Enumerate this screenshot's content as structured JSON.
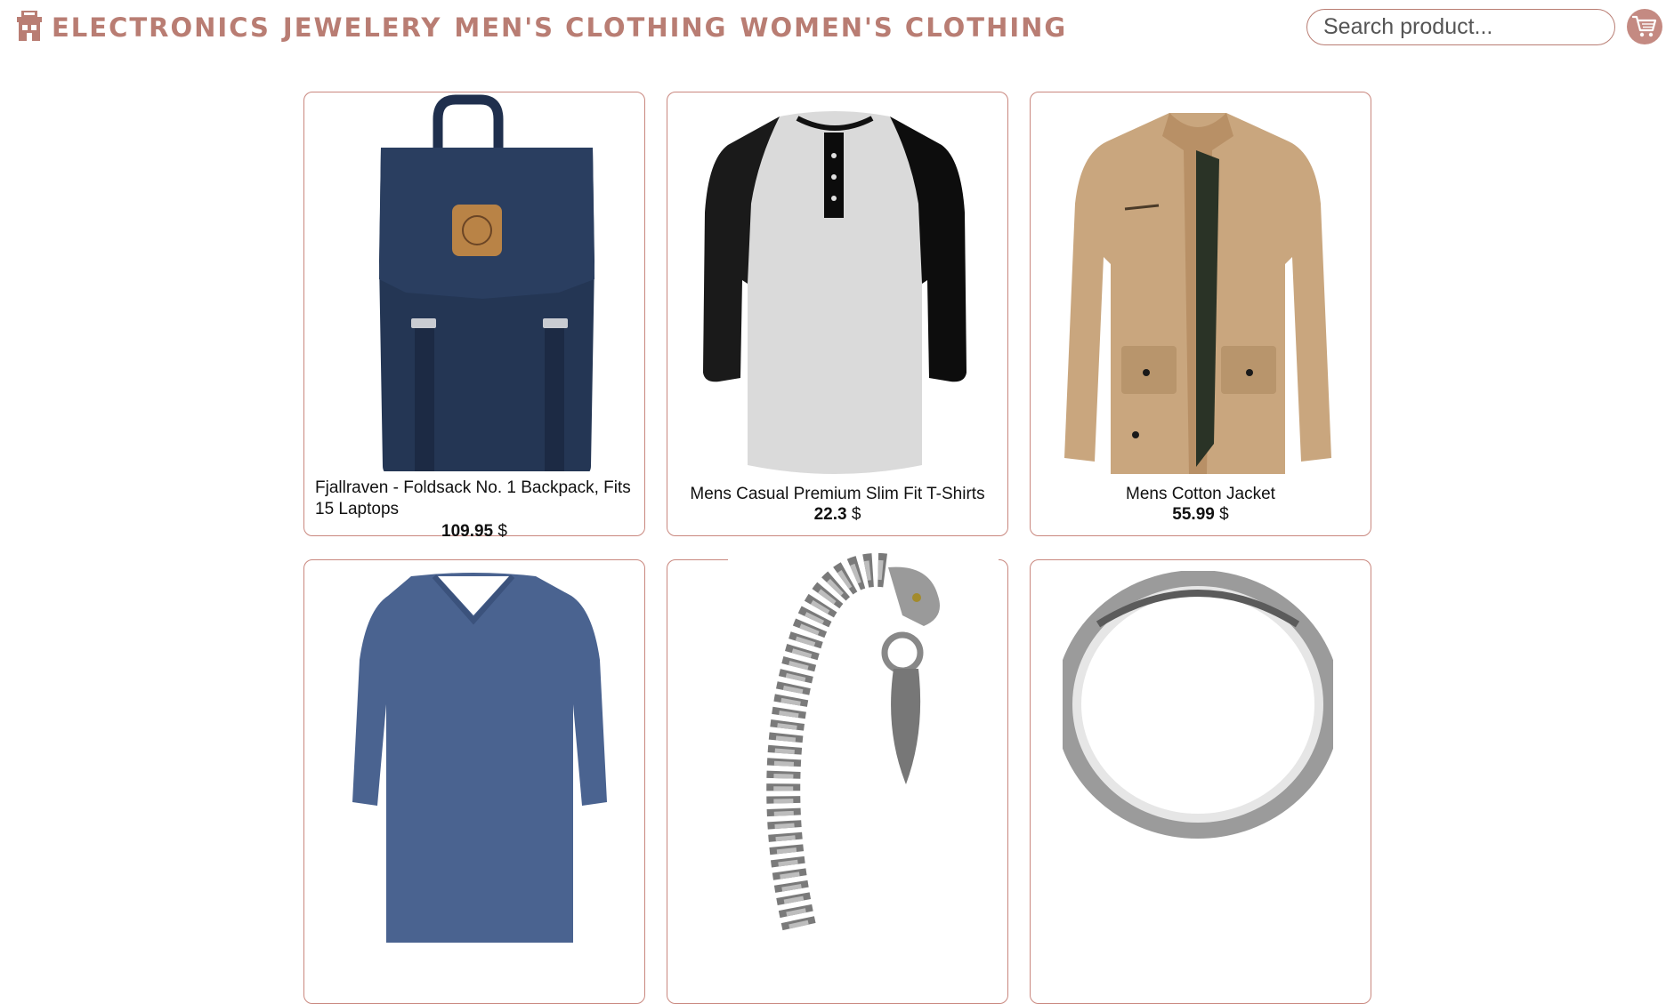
{
  "nav": {
    "logo_icon": "store-icon",
    "items": [
      {
        "label": "ELECTRONICS"
      },
      {
        "label": "JEWELERY"
      },
      {
        "label": "MEN'S CLOTHING"
      },
      {
        "label": "WOMEN'S CLOTHING"
      }
    ]
  },
  "search": {
    "placeholder": "Search product...",
    "value": ""
  },
  "cart": {
    "icon": "cart-icon"
  },
  "colors": {
    "accent": "#b97d73",
    "cart_bg": "#c48a82",
    "card_border": "#c9877e"
  },
  "currency": "$",
  "products": [
    {
      "title": "Fjallraven - Foldsack No. 1 Backpack, Fits 15 Laptops",
      "price": "109.95",
      "image": "navy-backpack"
    },
    {
      "title": "Mens Casual Premium Slim Fit T-Shirts",
      "price": "22.3",
      "image": "raglan-henley-tshirt"
    },
    {
      "title": "Mens Cotton Jacket",
      "price": "55.99",
      "image": "khaki-cotton-jacket"
    },
    {
      "title": "",
      "price": "",
      "image": "blue-vneck-tshirt"
    },
    {
      "title": "",
      "price": "",
      "image": "dragon-chain-bracelet"
    },
    {
      "title": "",
      "price": "",
      "image": "silver-ring"
    }
  ]
}
